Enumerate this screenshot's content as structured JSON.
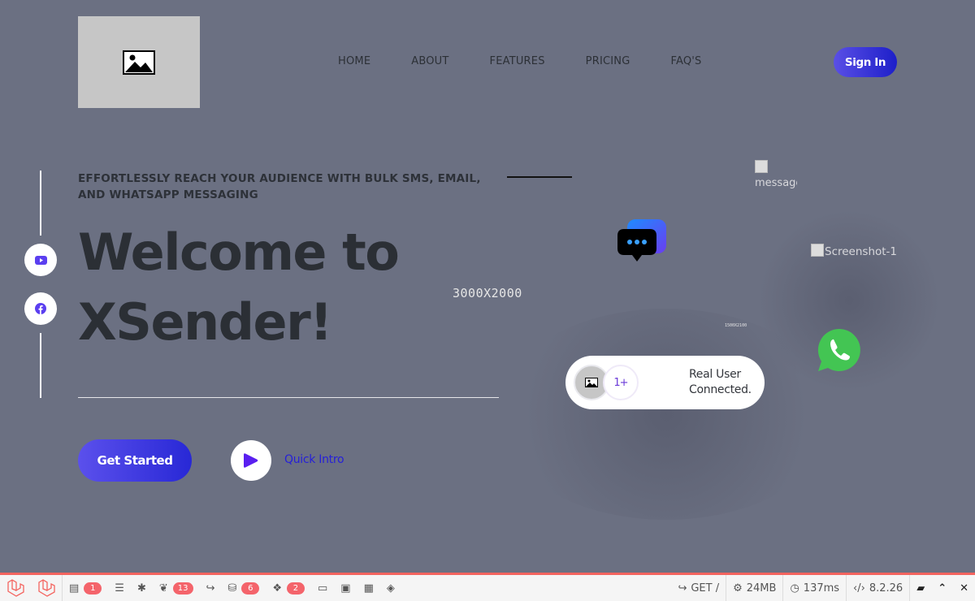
{
  "header": {
    "nav": [
      "HOME",
      "ABOUT",
      "FEATURES",
      "PRICING",
      "FAQ'S"
    ],
    "signin_label": "Sign In"
  },
  "hero": {
    "eyebrow": "EFFORTLESSLY REACH YOUR AUDIENCE WITH BULK SMS, EMAIL, AND WHATSAPP MESSAGING",
    "headline": "Welcome to XSender!",
    "image_placeholder": "3000X2000",
    "get_started_label": "Get Started",
    "quick_intro_label": "Quick Intro"
  },
  "visuals": {
    "message_alt": "message",
    "screenshot_alt": "Screenshot-1",
    "small_placeholder": "1500X2100",
    "user_count": "1+",
    "user_card_label": "Real User Connected."
  },
  "debugbar": {
    "messages_count": "1",
    "views_count": "13",
    "queries_count": "6",
    "models_count": "2",
    "route": "GET /",
    "memory": "24MB",
    "time": "137ms",
    "php_version": "8.2.26"
  },
  "colors": {
    "page_bg": "#6b7082",
    "accent": "#2a25d8",
    "whatsapp": "#43c553",
    "debug_accent": "#f4645f"
  }
}
